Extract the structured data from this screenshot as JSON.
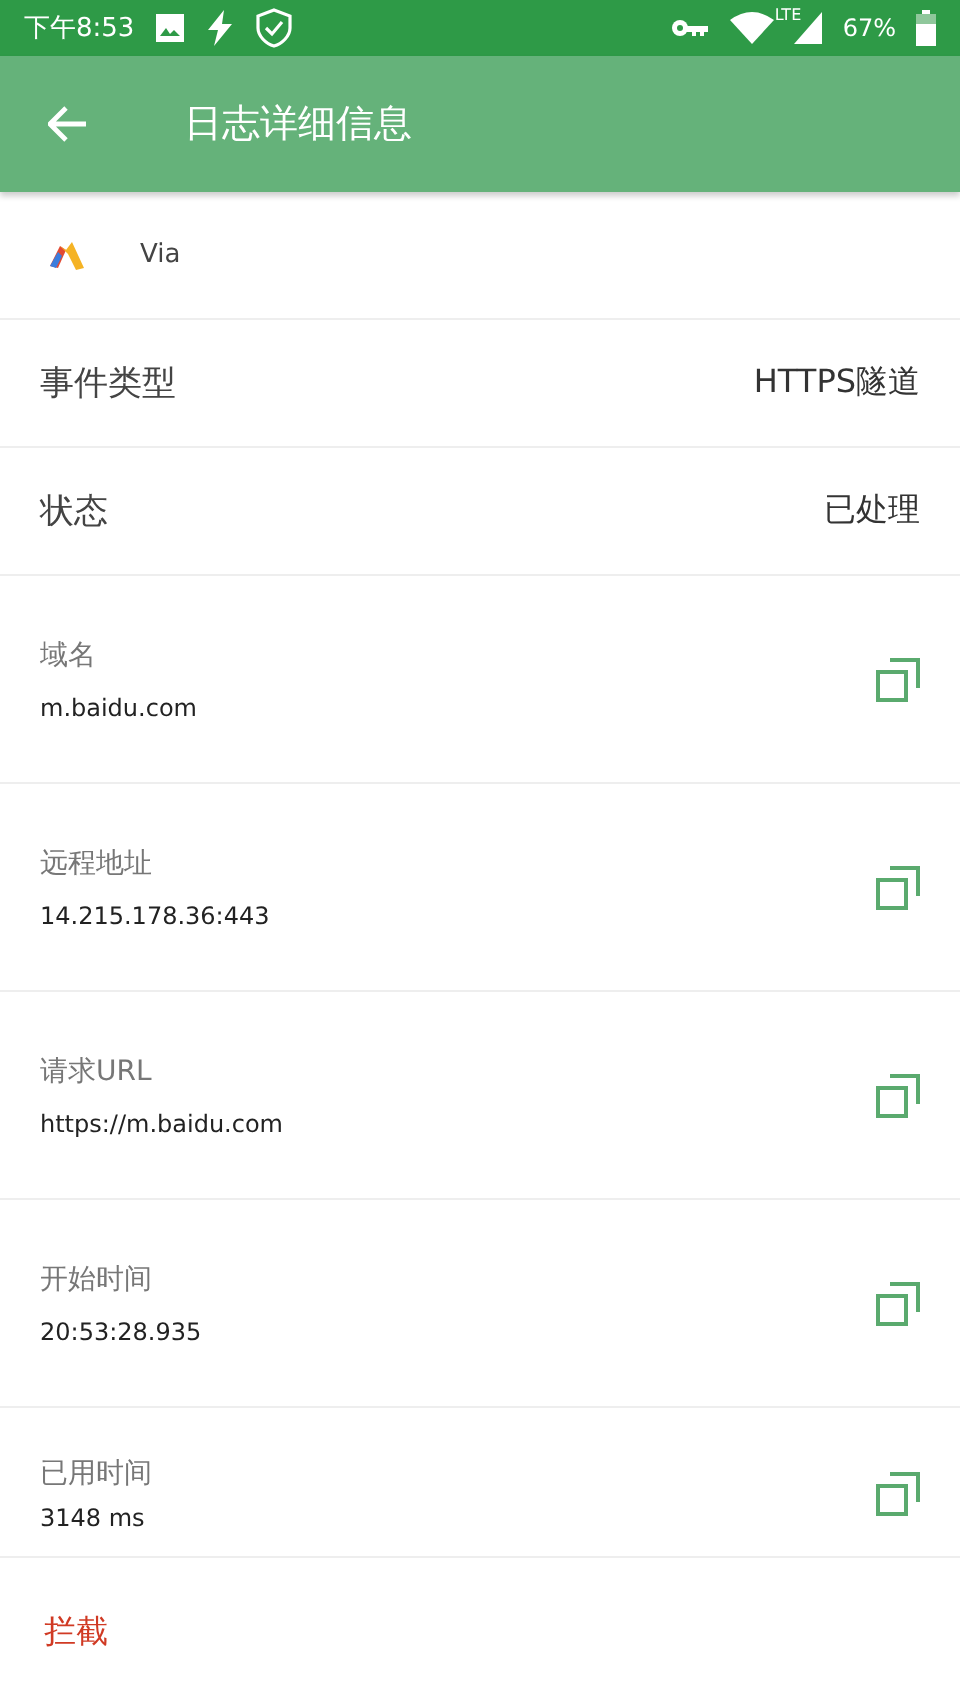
{
  "status_bar": {
    "time": "下午8:53",
    "network": "LTE",
    "battery": "67%"
  },
  "app_bar": {
    "title": "日志详细信息"
  },
  "app": {
    "name": "Via"
  },
  "summary": [
    {
      "label": "事件类型",
      "value": "HTTPS隧道"
    },
    {
      "label": "状态",
      "value": "已处理"
    }
  ],
  "details": [
    {
      "label": "域名",
      "value": "m.baidu.com"
    },
    {
      "label": "远程地址",
      "value": "14.215.178.36:443"
    },
    {
      "label": "请求URL",
      "value": "https://m.baidu.com"
    },
    {
      "label": "开始时间",
      "value": "20:53:28.935"
    },
    {
      "label": "已用时间",
      "value": "3148 ms"
    }
  ],
  "bottom_bar": {
    "action": "拦截"
  }
}
